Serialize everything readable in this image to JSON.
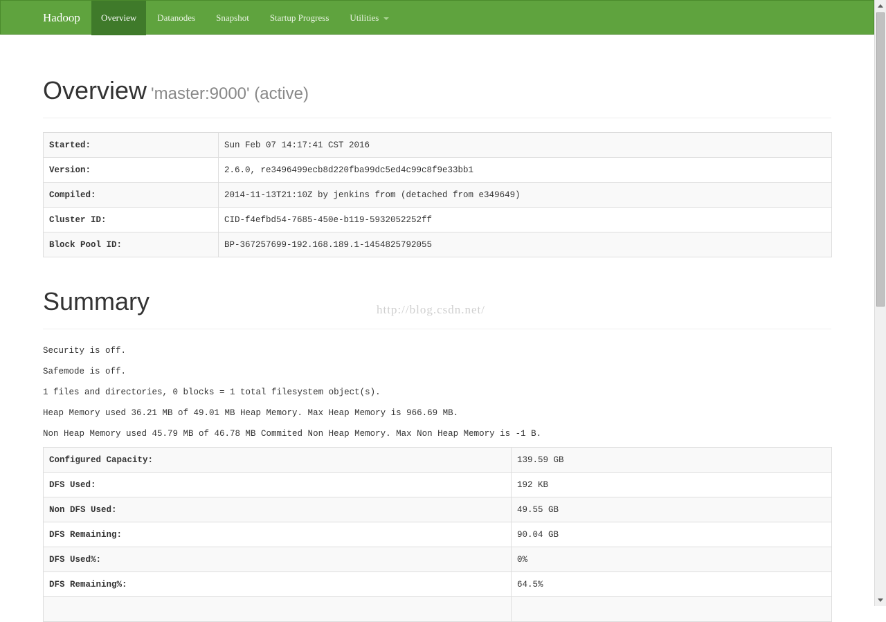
{
  "navbar": {
    "brand": "Hadoop",
    "items": [
      {
        "label": "Overview",
        "active": true
      },
      {
        "label": "Datanodes"
      },
      {
        "label": "Snapshot"
      },
      {
        "label": "Startup Progress"
      },
      {
        "label": "Utilities",
        "dropdown": true
      }
    ]
  },
  "overview": {
    "title": "Overview",
    "subtitle": "'master:9000' (active)",
    "rows": [
      {
        "key": "Started:",
        "value": "Sun Feb 07 14:17:41 CST 2016"
      },
      {
        "key": "Version:",
        "value": "2.6.0, re3496499ecb8d220fba99dc5ed4c99c8f9e33bb1"
      },
      {
        "key": "Compiled:",
        "value": "2014-11-13T21:10Z by jenkins from (detached from e349649)"
      },
      {
        "key": "Cluster ID:",
        "value": "CID-f4efbd54-7685-450e-b119-5932052252ff"
      },
      {
        "key": "Block Pool ID:",
        "value": "BP-367257699-192.168.189.1-1454825792055"
      }
    ]
  },
  "summary": {
    "title": "Summary",
    "lines": [
      "Security is off.",
      "Safemode is off.",
      "1 files and directories, 0 blocks = 1 total filesystem object(s).",
      "Heap Memory used 36.21 MB of 49.01 MB Heap Memory. Max Heap Memory is 966.69 MB.",
      "Non Heap Memory used 45.79 MB of 46.78 MB Commited Non Heap Memory. Max Non Heap Memory is -1 B."
    ],
    "rows": [
      {
        "key": "Configured Capacity:",
        "value": "139.59 GB"
      },
      {
        "key": "DFS Used:",
        "value": "192 KB"
      },
      {
        "key": "Non DFS Used:",
        "value": "49.55 GB"
      },
      {
        "key": "DFS Remaining:",
        "value": "90.04 GB"
      },
      {
        "key": "DFS Used%:",
        "value": "0%"
      },
      {
        "key": "DFS Remaining%:",
        "value": "64.5%"
      },
      {
        "key": "",
        "value": ""
      }
    ]
  },
  "watermark": "http://blog.csdn.net/",
  "colors": {
    "navbar": "#5fa33e",
    "navbar_active": "#3f7a2a"
  }
}
